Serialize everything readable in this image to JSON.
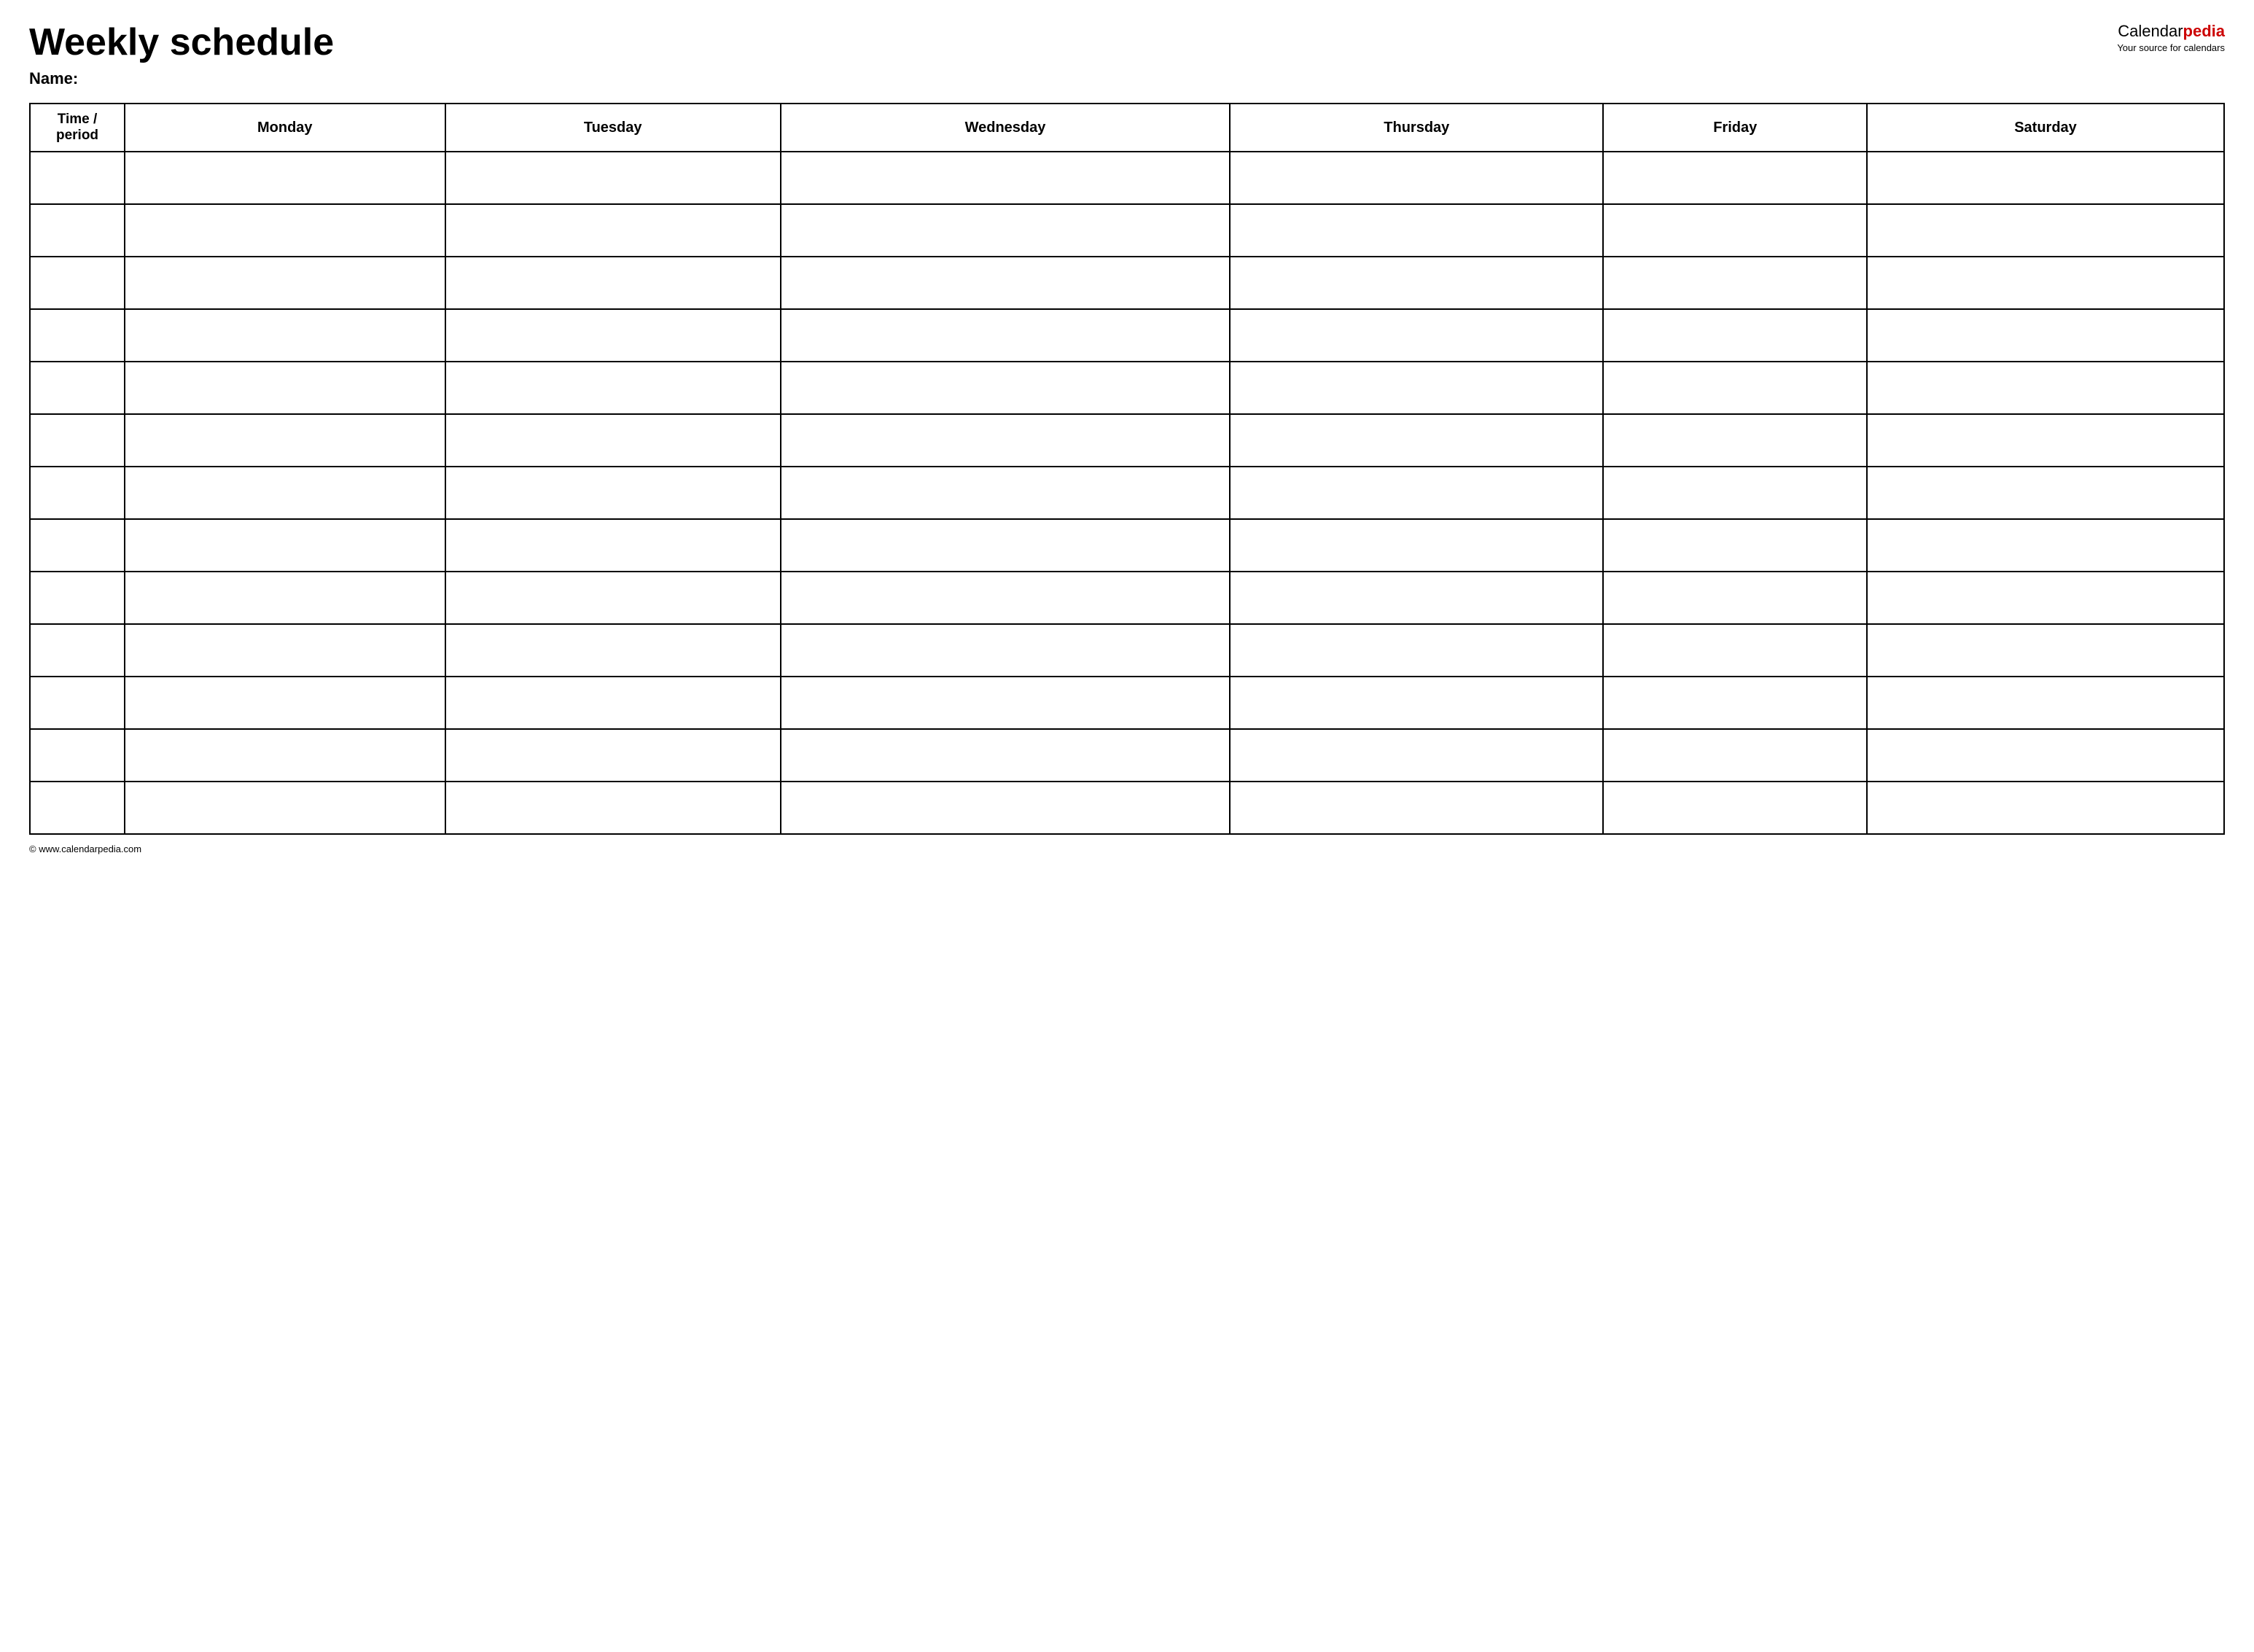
{
  "header": {
    "title": "Weekly schedule",
    "name_label": "Name:",
    "logo": {
      "calendar_text": "Calendar",
      "pedia_text": "pedia",
      "tagline": "Your source for calendars"
    }
  },
  "table": {
    "columns": [
      {
        "label": "Time / period",
        "key": "time"
      },
      {
        "label": "Monday",
        "key": "monday"
      },
      {
        "label": "Tuesday",
        "key": "tuesday"
      },
      {
        "label": "Wednesday",
        "key": "wednesday"
      },
      {
        "label": "Thursday",
        "key": "thursday"
      },
      {
        "label": "Friday",
        "key": "friday"
      },
      {
        "label": "Saturday",
        "key": "saturday"
      }
    ],
    "rows": 13
  },
  "footer": {
    "copyright": "© www.calendarpedia.com"
  }
}
